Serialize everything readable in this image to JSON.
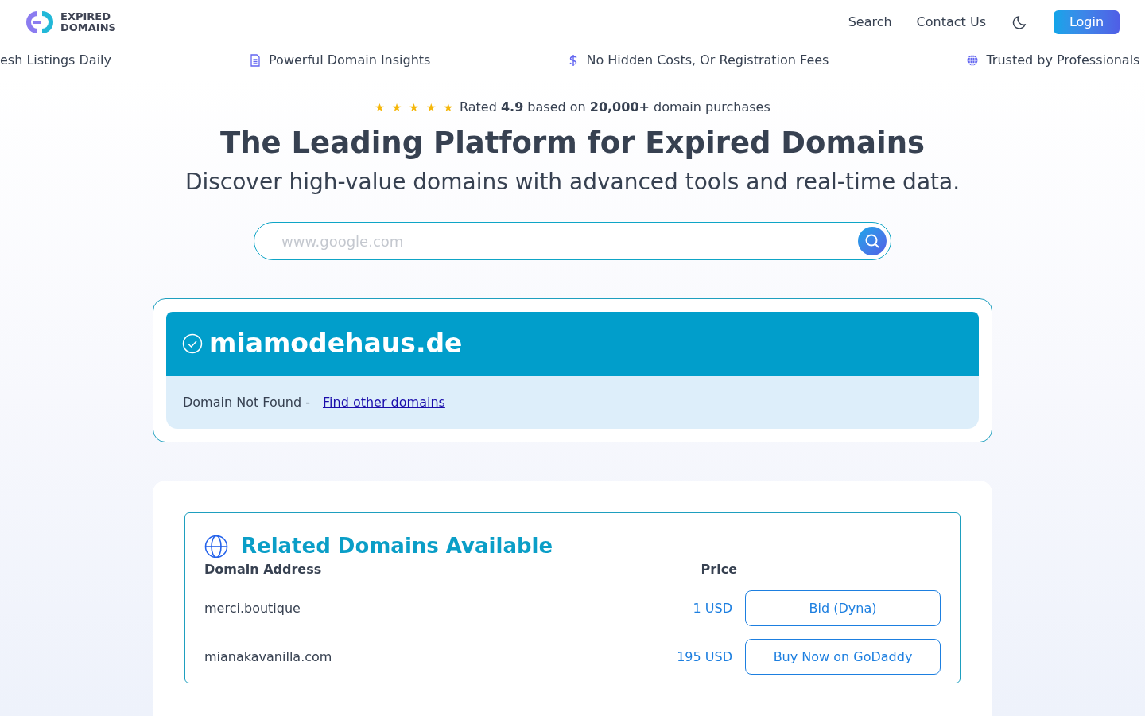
{
  "header": {
    "logo": {
      "line1": "EXPIRED",
      "line2": "DOMAINS"
    },
    "nav": [
      "Search",
      "Contact Us"
    ],
    "login": "Login"
  },
  "ticker": [
    {
      "label": "esh Listings Daily",
      "kind": "cut"
    },
    {
      "label": "Powerful Domain Insights",
      "kind": "document"
    },
    {
      "label": "No Hidden Costs, Or Registration Fees",
      "kind": "dollar"
    },
    {
      "label": "Trusted by Professionals",
      "kind": "globe"
    }
  ],
  "rating": {
    "stars": 5,
    "text": "Rated **4.9** based on **20,000+** domain purchases"
  },
  "hero": {
    "title": "The Leading Platform for Expired Domains",
    "subtitle": "Discover high-value domains with advanced tools and real-time data.",
    "search": {
      "placeholder": "www.google.com"
    }
  },
  "result": {
    "domain": "miamodehaus.de",
    "status": "Domain Not Found -",
    "link": "Find other domains"
  },
  "related": {
    "title": "Related Domains Available",
    "columns": [
      "Domain Address",
      "Price"
    ],
    "rows": [
      {
        "domain": "merci.boutique",
        "price": "1 USD",
        "action": "Bid (Dyna)"
      },
      {
        "domain": "mianakavanilla.com",
        "price": "195 USD",
        "action": "Buy Now on GoDaddy"
      }
    ]
  }
}
